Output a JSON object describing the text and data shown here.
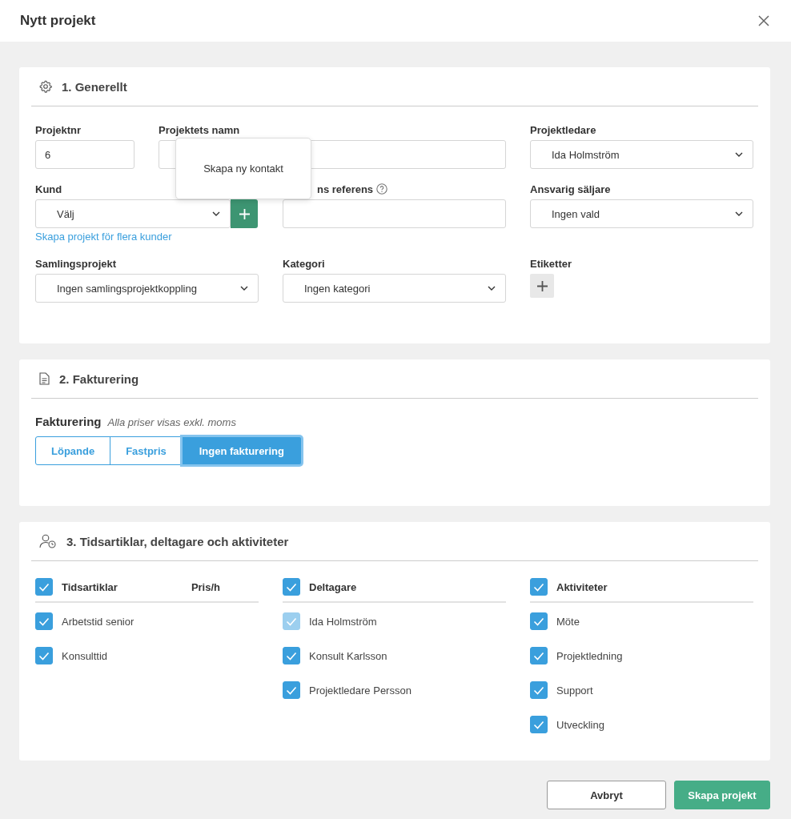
{
  "dialog": {
    "title": "Nytt projekt"
  },
  "general": {
    "title": "1. Generellt",
    "rows": [
      [
        {
          "kind": "text",
          "label": "Projektnr",
          "value": "6"
        },
        {
          "kind": "text",
          "label": "Projektets namn"
        },
        {
          "kind": "select",
          "label": "Projektledare",
          "value": "Ida Holmström"
        }
      ],
      [
        {
          "kind": "select_add",
          "label": "Kund",
          "value": "Välj",
          "link": "Skapa projekt för flera kunder"
        },
        {
          "kind": "text",
          "label": "ns referens",
          "help": true
        },
        {
          "kind": "select",
          "label": "Ansvarig säljare",
          "value": "Ingen vald"
        }
      ],
      [
        {
          "kind": "select",
          "label": "Samlingsprojekt",
          "value": "Ingen samlingsprojektkoppling"
        },
        {
          "kind": "select",
          "label": "Kategori",
          "value": "Ingen kategori"
        },
        {
          "kind": "tags",
          "label": "Etiketter"
        }
      ]
    ]
  },
  "popover": {
    "text": "Skapa ny kontakt"
  },
  "billing": {
    "title": "2. Fakturering",
    "label": "Fakturering",
    "note": "Alla priser visas exkl. moms",
    "options": [
      {
        "label": "Löpande",
        "selected": false
      },
      {
        "label": "Fastpris",
        "selected": false
      },
      {
        "label": "Ingen fakturering",
        "selected": true
      }
    ]
  },
  "participants": {
    "title": "3. Tidsartiklar, deltagare och aktiviteter",
    "columns": [
      {
        "header": "Tidsartiklar",
        "checked": true,
        "extra_header": "Pris/h",
        "items": [
          {
            "label": "Arbetstid senior",
            "checked": true,
            "disabled": false
          },
          {
            "label": "Konsulttid",
            "checked": true,
            "disabled": false
          }
        ]
      },
      {
        "header": "Deltagare",
        "checked": true,
        "items": [
          {
            "label": "Ida Holmström",
            "checked": true,
            "disabled": true
          },
          {
            "label": "Konsult Karlsson",
            "checked": true,
            "disabled": false
          },
          {
            "label": "Projektledare Persson",
            "checked": true,
            "disabled": false
          }
        ]
      },
      {
        "header": "Aktiviteter",
        "checked": true,
        "items": [
          {
            "label": "Möte",
            "checked": true,
            "disabled": false
          },
          {
            "label": "Projektledning",
            "checked": true,
            "disabled": false
          },
          {
            "label": "Support",
            "checked": true,
            "disabled": false
          },
          {
            "label": "Utveckling",
            "checked": true,
            "disabled": false
          }
        ]
      }
    ]
  },
  "footer": {
    "buttons": [
      {
        "label": "Avbryt",
        "kind": "secondary"
      },
      {
        "label": "Skapa projekt",
        "kind": "primary"
      }
    ]
  }
}
